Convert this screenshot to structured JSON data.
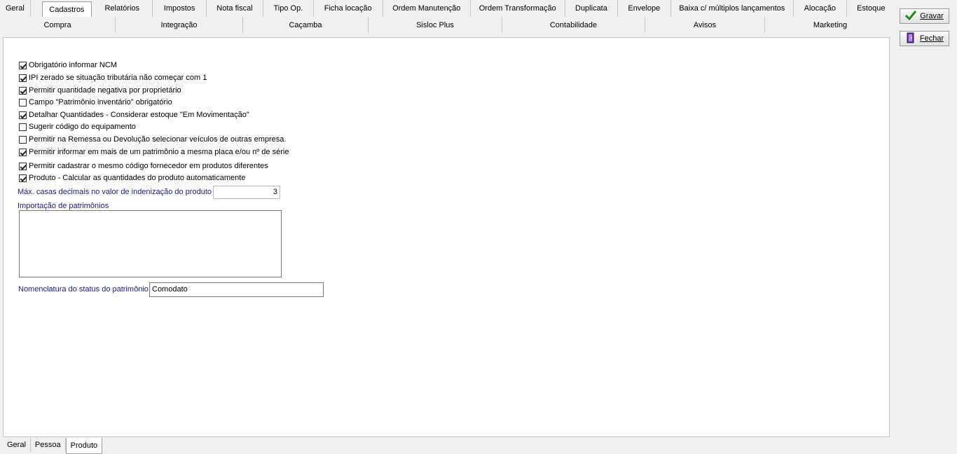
{
  "top_tabs_row1": [
    "Geral",
    "Cadastros",
    "Relatórios",
    "Impostos",
    "Nota fiscal",
    "Tipo Op.",
    "Ficha locação",
    "Ordem Manutenção",
    "Ordem Transformação",
    "Duplicata",
    "Envelope",
    "Baixa c/ múltiplos lançamentos",
    "Alocação",
    "Estoque"
  ],
  "top_tabs_row2": [
    "Compra",
    "Integração",
    "Caçamba",
    "Sisloc Plus",
    "Contabilidade",
    "Avisos",
    "Marketing"
  ],
  "active_top_tab": "Cadastros",
  "buttons": {
    "save_label": "Gravar",
    "close_label": "Fechar"
  },
  "options": [
    {
      "label": "Obrigatório informar NCM",
      "checked": true
    },
    {
      "label": "IPI zerado se situação tributária não começar com 1",
      "checked": true
    },
    {
      "label": "Permitir quantidade negativa por proprietário",
      "checked": true
    },
    {
      "label": "Campo \"Patrimônio inventário\" obrigatório",
      "checked": false
    },
    {
      "label": "Detalhar Quantidades - Considerar estoque \"Em Movimentação\"",
      "checked": true
    },
    {
      "label": "Sugerir código do equipamento",
      "checked": false
    },
    {
      "label": "Permitir na Remessa ou Devolução selecionar veículos de outras empresa.",
      "checked": false
    },
    {
      "label": "Permitir informar em mais de um patrimônio a mesma placa e/ou nº de série",
      "checked": true
    },
    {
      "label": "Permitir cadastrar o mesmo código fornecedor em produtos diferentes",
      "checked": true
    },
    {
      "label": "Produto - Calcular as quantidades do produto automaticamente",
      "checked": true
    }
  ],
  "decimal_places": {
    "label": "Máx. casas decimais no valor de indenização do produto",
    "value": "3"
  },
  "import": {
    "label": "Importação de patrimônios",
    "value": ""
  },
  "status_name": {
    "label": "Nomenclatura do status do patrimônio",
    "value": "Comodato"
  },
  "bottom_tabs": [
    "Geral",
    "Pessoa",
    "Produto"
  ],
  "active_bottom_tab": "Produto"
}
